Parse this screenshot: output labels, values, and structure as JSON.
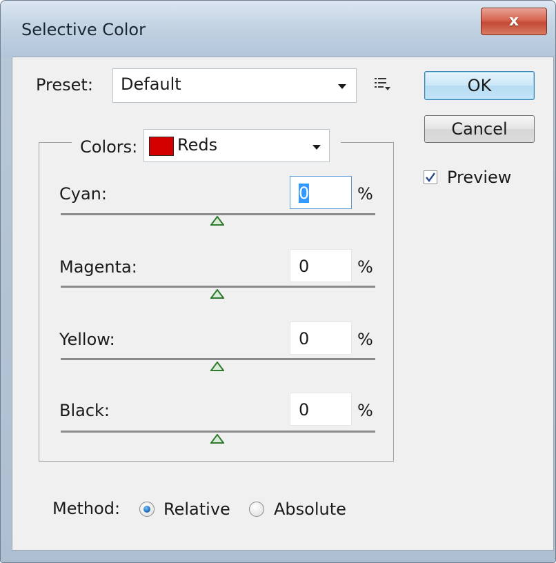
{
  "window": {
    "title": "Selective Color",
    "close_glyph": "x"
  },
  "preset": {
    "label": "Preset:",
    "value": "Default",
    "menu_icon": "list-options-icon"
  },
  "buttons": {
    "ok": "OK",
    "cancel": "Cancel"
  },
  "preview": {
    "label": "Preview",
    "checked": true
  },
  "colors": {
    "label": "Colors:",
    "value": "Reds",
    "swatch_color": "#d40000"
  },
  "sliders": [
    {
      "label": "Cyan:",
      "value": "0",
      "unit": "%"
    },
    {
      "label": "Magenta:",
      "value": "0",
      "unit": "%"
    },
    {
      "label": "Yellow:",
      "value": "0",
      "unit": "%"
    },
    {
      "label": "Black:",
      "value": "0",
      "unit": "%"
    }
  ],
  "method": {
    "label": "Method:",
    "options": [
      {
        "label": "Relative",
        "checked": true
      },
      {
        "label": "Absolute",
        "checked": false
      }
    ]
  }
}
